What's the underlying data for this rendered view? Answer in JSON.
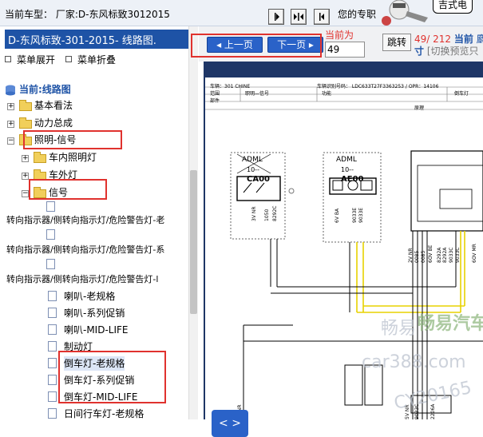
{
  "topbar": {
    "current_model_label": "当前车型：",
    "manufacturer": "厂家:D-东风标致3012015",
    "quote_text": "您的专职",
    "brand_text": "吉式电"
  },
  "left_panel": {
    "header": "D-东风标致-301-2015- 线路图.",
    "controls": {
      "expand": "菜单展开",
      "collapse": "菜单折叠"
    },
    "current_label": "当前:线路图",
    "tree": [
      {
        "label": "基本看法",
        "type": "folder"
      },
      {
        "label": "动力总成",
        "type": "folder"
      },
      {
        "label": "照明-信号",
        "type": "folder"
      },
      {
        "label": "车内照明灯",
        "type": "folder"
      },
      {
        "label": "车外灯",
        "type": "folder"
      },
      {
        "label": "信号",
        "type": "folder"
      },
      {
        "label": "转向指示器/侧转向指示灯/危险警告灯-老",
        "type": "doc"
      },
      {
        "label": "转向指示器/侧转向指示灯/危险警告灯-系",
        "type": "doc"
      },
      {
        "label": "转向指示器/侧转向指示灯/危险警告灯-l",
        "type": "doc"
      },
      {
        "label": "喇叭-老规格",
        "type": "doc"
      },
      {
        "label": "喇叭-系列促销",
        "type": "doc"
      },
      {
        "label": "喇叭-MID-LIFE",
        "type": "doc"
      },
      {
        "label": "制动灯",
        "type": "doc"
      },
      {
        "label": "倒车灯-老规格",
        "type": "doc"
      },
      {
        "label": "倒车灯-系列促销",
        "type": "doc"
      },
      {
        "label": "倒车灯-MID-LIFE",
        "type": "doc"
      },
      {
        "label": "日间行车灯-老规格",
        "type": "doc"
      }
    ]
  },
  "right_panel": {
    "prev_page": "上一页",
    "next_page": "下一页",
    "current_page_label": "当前为",
    "page_input": "49",
    "jump_button": "跳转",
    "page_count": "49/ 212",
    "current_label_right": "当前",
    "right_cut": "麝",
    "line2_cut": "寸",
    "switch_hint": "[切换预览只",
    "nav_arrows": "< >"
  },
  "diagram": {
    "header_row1": "车辆：301 CHINE",
    "header_vin": "车辆识别号码：  LDC633T27F3363253 / OPR：14106",
    "col1": "范围",
    "col2": "职明—信号",
    "col3": "功能",
    "col4": "倒车灯",
    "row2": "部件",
    "principle": "原理",
    "comp1_name": "ADML",
    "comp1_sub": "10--",
    "comp1_code": "CA00",
    "comp2_name": "ADML",
    "comp2_sub": "10--",
    "comp2_code": "AE00",
    "wires1": [
      "3V NR",
      "1050",
      "8292C"
    ],
    "wires2": [
      "6V BA",
      "9033E",
      "9033E"
    ],
    "wires3": [
      "2V NR",
      "0085",
      "0085",
      "6OV BE",
      "8292A",
      "8292A",
      "9033C",
      "9033C",
      "6OV MR"
    ],
    "bottom_wires": [
      "2V NR",
      "5V NR",
      "9033C",
      "2206A"
    ]
  },
  "watermarks": [
    "畅易",
    "畅易汽车",
    "car388.com",
    "CY20165"
  ]
}
